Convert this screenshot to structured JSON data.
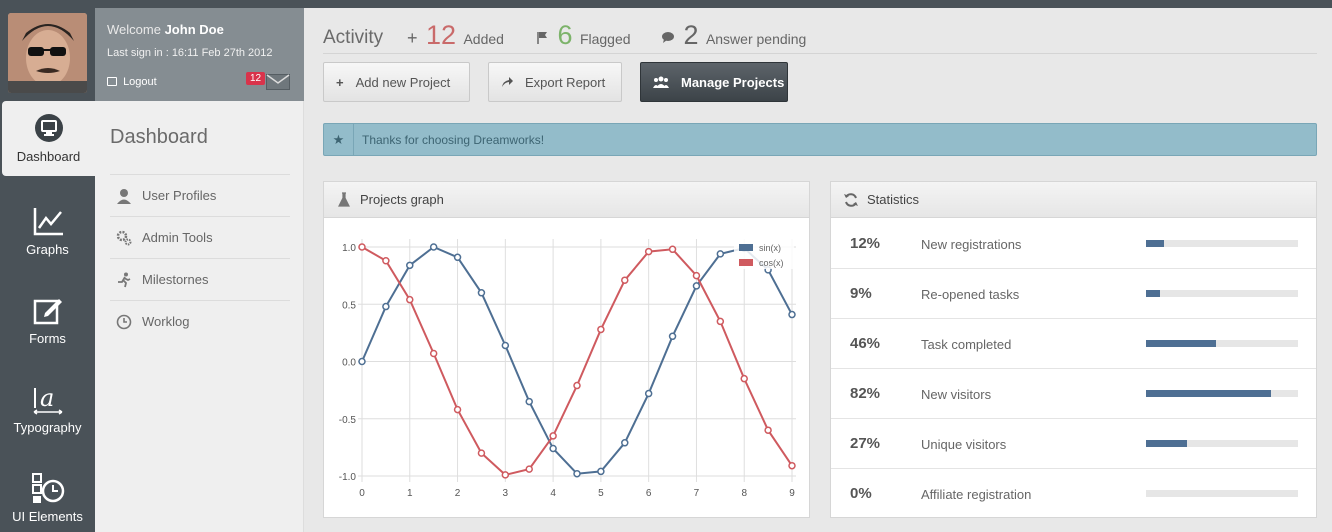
{
  "nav": {
    "items": [
      {
        "label": "Dashboard",
        "icon": "monitor-icon",
        "active": true
      },
      {
        "label": "Graphs",
        "icon": "line-chart-icon"
      },
      {
        "label": "Forms",
        "icon": "edit-icon"
      },
      {
        "label": "Typography",
        "icon": "typography-icon"
      },
      {
        "label": "UI Elements",
        "icon": "ui-elements-icon"
      }
    ]
  },
  "user": {
    "welcome": "Welcome",
    "name": "John Doe",
    "last_sign": "Last sign in : 16:11 Feb 27th 2012",
    "logout": "Logout",
    "mail_count": "12"
  },
  "sidebar": {
    "title": "Dashboard",
    "items": [
      {
        "label": "User Profiles",
        "icon": "user-icon"
      },
      {
        "label": "Admin Tools",
        "icon": "gears-icon"
      },
      {
        "label": "Milestornes",
        "icon": "runner-icon"
      },
      {
        "label": "Worklog",
        "icon": "clock-icon"
      }
    ]
  },
  "activity": {
    "title": "Activity",
    "added": {
      "num": "12",
      "label": "Added",
      "color": "#c96a6a"
    },
    "flagged": {
      "num": "6",
      "label": "Flagged",
      "color": "#7cb36a"
    },
    "pending": {
      "num": "2",
      "label": "Answer pending",
      "color": "#666666"
    }
  },
  "buttons": {
    "add": "Add new Project",
    "export": "Export Report",
    "manage": "Manage Projects"
  },
  "alert": {
    "text": "Thanks for choosing Dreamworks!"
  },
  "graph": {
    "title": "Projects graph"
  },
  "statistics": {
    "title": "Statistics",
    "rows": [
      {
        "pct": "12%",
        "label": "New registrations",
        "value": 12
      },
      {
        "pct": "9%",
        "label": "Re-opened tasks",
        "value": 9
      },
      {
        "pct": "46%",
        "label": "Task completed",
        "value": 46
      },
      {
        "pct": "82%",
        "label": "New visitors",
        "value": 82
      },
      {
        "pct": "27%",
        "label": "Unique visitors",
        "value": 27
      },
      {
        "pct": "0%",
        "label": "Affiliate registration",
        "value": 0
      }
    ]
  },
  "chart_data": {
    "type": "line",
    "title": "",
    "xlim": [
      0,
      9
    ],
    "ylim": [
      -1.0,
      1.0
    ],
    "xticks": [
      "0",
      "1",
      "2",
      "3",
      "4",
      "5",
      "6",
      "7",
      "8",
      "9"
    ],
    "yticks": [
      "1.0",
      "0.5",
      "0.0",
      "-0.5",
      "-1.0"
    ],
    "x": [
      0,
      0.5,
      1,
      1.5,
      2,
      2.5,
      3,
      3.5,
      4,
      4.5,
      5,
      5.5,
      6,
      6.5,
      7,
      7.5,
      8,
      8.5,
      9
    ],
    "series": [
      {
        "name": "sin(x)",
        "color": "#4e6f93",
        "values": [
          0,
          0.48,
          0.84,
          1.0,
          0.91,
          0.6,
          0.14,
          -0.35,
          -0.76,
          -0.98,
          -0.96,
          -0.71,
          -0.28,
          0.22,
          0.66,
          0.94,
          0.99,
          0.8,
          0.41
        ]
      },
      {
        "name": "cos(x)",
        "color": "#cf5a5f",
        "values": [
          1.0,
          0.88,
          0.54,
          0.07,
          -0.42,
          -0.8,
          -0.99,
          -0.94,
          -0.65,
          -0.21,
          0.28,
          0.71,
          0.96,
          0.98,
          0.75,
          0.35,
          -0.15,
          -0.6,
          -0.91
        ]
      }
    ],
    "legend": "top-right",
    "grid": true
  }
}
